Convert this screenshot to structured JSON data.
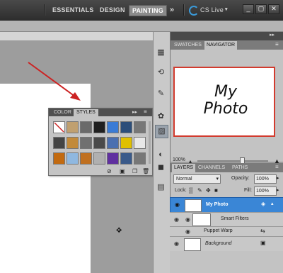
{
  "topbar": {
    "workspaces": [
      "ESSENTIALS",
      "DESIGN",
      "PAINTING"
    ],
    "active_workspace": "PAINTING",
    "more": "»",
    "cs_live": "CS Live",
    "window_buttons": [
      "_",
      "▢",
      "✕"
    ]
  },
  "styles_panel": {
    "tabs": [
      "COLOR",
      "STYLES"
    ],
    "active_tab": "STYLES",
    "header_icons": [
      "▸▸",
      "≡"
    ],
    "swatch_colors": [
      [
        "#ffffff",
        "#c0a070",
        "#6a6a6a",
        "#202020",
        "#3a7bd5",
        "#2c4e7a",
        "#777777"
      ],
      [
        "#444444",
        "#c28a3a",
        "#707070",
        "#4a4a4a",
        "#4a6fb0",
        "#e0c000",
        "#e8e8e8"
      ],
      [
        "#c26a10",
        "#8fb8e0",
        "#c07020",
        "#b0b0b0",
        "#6030a0",
        "#3a5a8a",
        "#777777"
      ]
    ]
  },
  "navigator_panel": {
    "tabs": [
      "SWATCHES",
      "NAVIGATOR"
    ],
    "active_tab": "NAVIGATOR",
    "preview_text_line1": "My",
    "preview_text_line2": "Photo",
    "zoom": "100%"
  },
  "layers_panel": {
    "tabs": [
      "LAYERS",
      "CHANNELS",
      "PATHS"
    ],
    "active_tab": "LAYERS",
    "blend_mode": "Normal",
    "opacity_label": "Opacity:",
    "opacity_value": "100%",
    "lock_label": "Lock:",
    "fill_label": "Fill:",
    "fill_value": "100%",
    "layers": [
      {
        "name": "My Photo",
        "selected": true
      },
      {
        "name": "Smart Filters",
        "selected": false
      },
      {
        "name": "Puppet Warp",
        "selected": false
      },
      {
        "name": "Background",
        "selected": false
      }
    ]
  },
  "colors": {
    "accent_blue": "#3a86d6",
    "nav_frame_red": "#d23b2e",
    "arrow_red": "#cc2222"
  }
}
